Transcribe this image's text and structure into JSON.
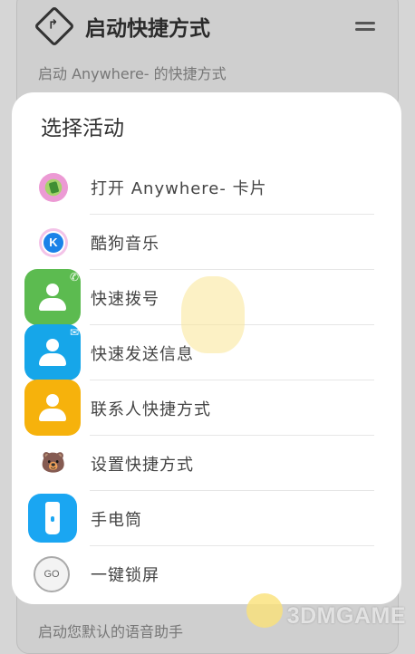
{
  "background": {
    "title": "启动快捷方式",
    "subtitle": "启动 Anywhere- 的快捷方式",
    "bottom_text": "启动您默认的语音助手"
  },
  "dialog": {
    "title": "选择活动",
    "items": [
      {
        "label": "打开 Anywhere- 卡片",
        "icon": "anywhere-icon"
      },
      {
        "label": "酷狗音乐",
        "icon": "kugou-icon"
      },
      {
        "label": "快速拨号",
        "icon": "contact-dial-icon"
      },
      {
        "label": "快速发送信息",
        "icon": "contact-message-icon"
      },
      {
        "label": "联系人快捷方式",
        "icon": "contact-icon"
      },
      {
        "label": "设置快捷方式",
        "icon": "bear-icon"
      },
      {
        "label": "手电筒",
        "icon": "flashlight-icon"
      },
      {
        "label": "一键锁屏",
        "icon": "lock-screen-icon"
      }
    ]
  },
  "kugou_letter": "K",
  "lock_letters": "GO",
  "watermark": "3DMGAME",
  "colors": {
    "dial": "#5cbb50",
    "message": "#16a6e9",
    "contact": "#f6b20c",
    "flashlight": "#1aa6f2"
  }
}
